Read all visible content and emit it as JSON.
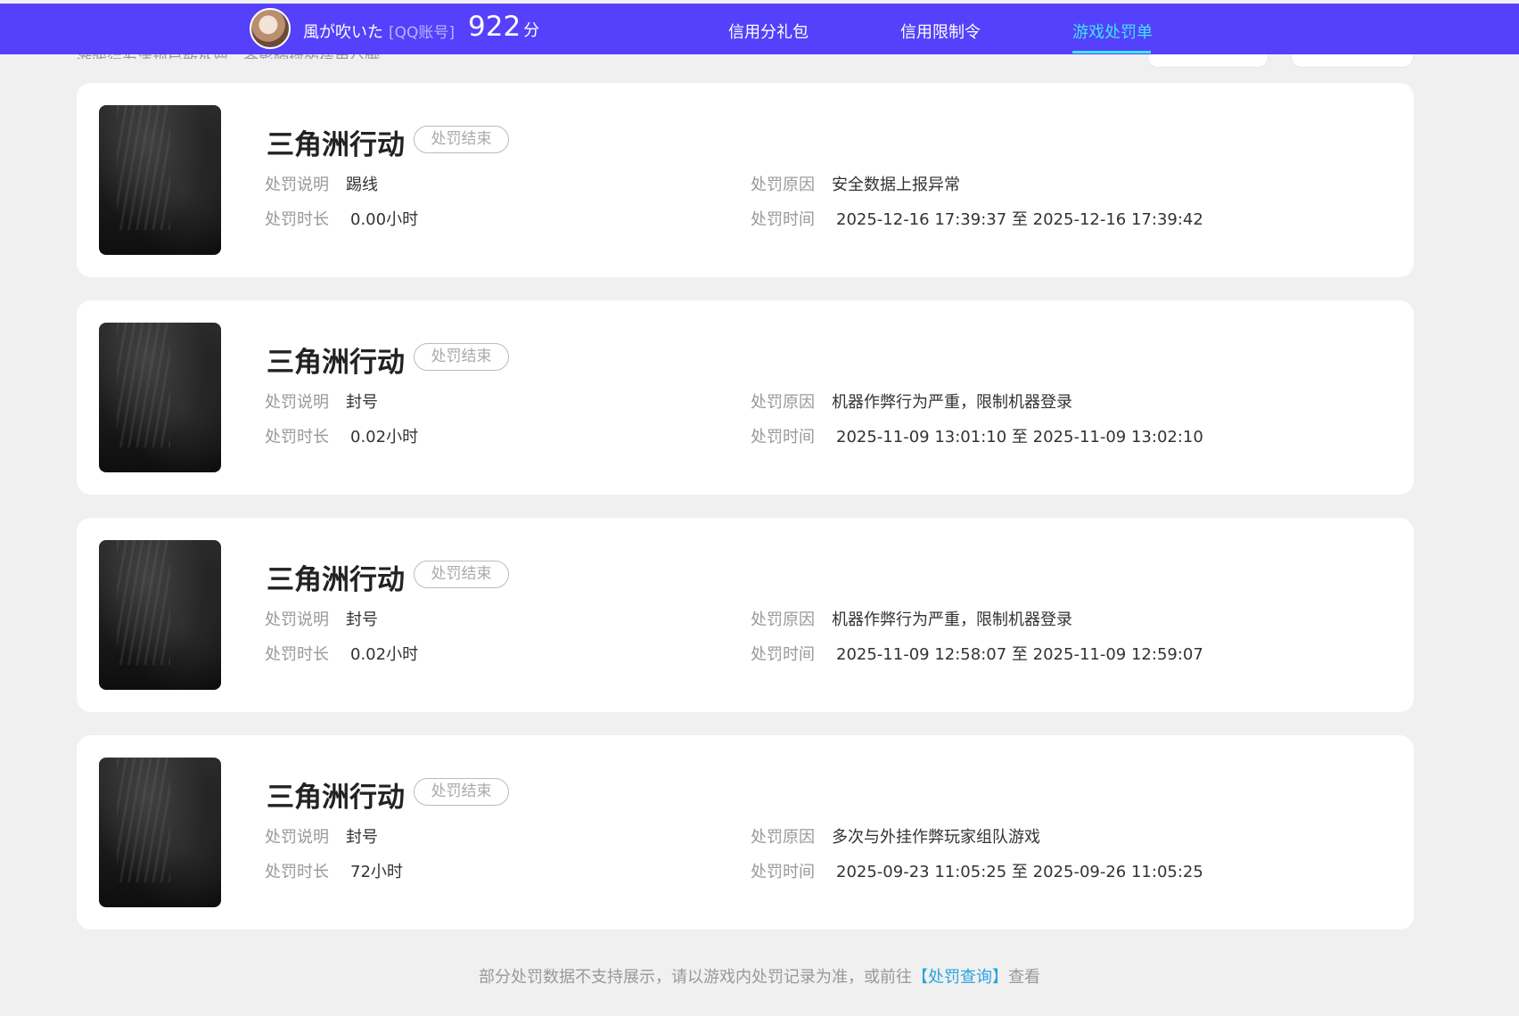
{
  "header": {
    "user_name": "風が吹いた",
    "account_type": "[QQ账号]",
    "score": "922",
    "score_unit": "分",
    "tabs": [
      {
        "label": "信用分礼包",
        "active": false
      },
      {
        "label": "信用限制令",
        "active": false
      },
      {
        "label": "游戏处罚单",
        "active": true
      }
    ],
    "active_color": "#3ee6f5",
    "bar_color": "#5540fb"
  },
  "intro_text": "游戏行为违规导致处罚，会影响您的信用分哦",
  "labels": {
    "desc": "处罚说明",
    "reason": "处罚原因",
    "duration": "处罚时长",
    "time": "处罚时间",
    "time_sep": "至"
  },
  "records": [
    {
      "game": "三角洲行动",
      "status": "处罚结束",
      "desc": "踢线",
      "reason": "安全数据上报异常",
      "duration": "0.00小时",
      "start": "2025-12-16 17:39:37",
      "end": "2025-12-16 17:39:42"
    },
    {
      "game": "三角洲行动",
      "status": "处罚结束",
      "desc": "封号",
      "reason": "机器作弊行为严重，限制机器登录",
      "duration": "0.02小时",
      "start": "2025-11-09 13:01:10",
      "end": "2025-11-09 13:02:10"
    },
    {
      "game": "三角洲行动",
      "status": "处罚结束",
      "desc": "封号",
      "reason": "机器作弊行为严重，限制机器登录",
      "duration": "0.02小时",
      "start": "2025-11-09 12:58:07",
      "end": "2025-11-09 12:59:07"
    },
    {
      "game": "三角洲行动",
      "status": "处罚结束",
      "desc": "封号",
      "reason": "多次与外挂作弊玩家组队游戏",
      "duration": "72小时",
      "start": "2025-09-23 11:05:25",
      "end": "2025-09-26 11:05:25"
    }
  ],
  "footer": {
    "text_before": "部分处罚数据不支持展示，请以游戏内处罚记录为准，或前往",
    "link": "【处罚查询】",
    "text_after": "查看"
  }
}
